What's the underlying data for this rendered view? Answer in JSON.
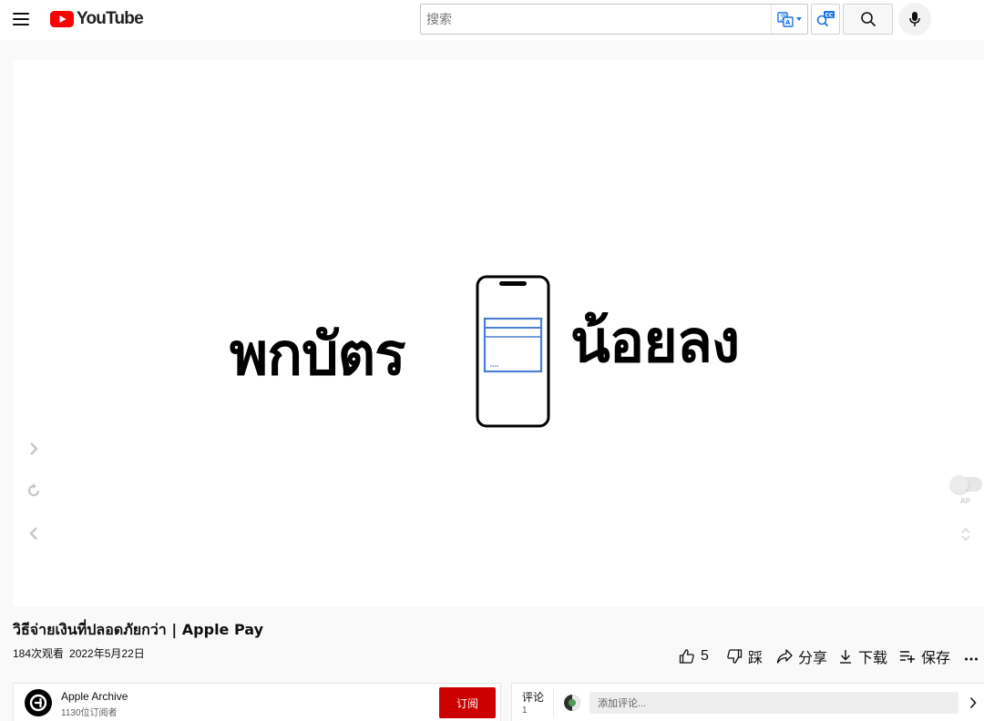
{
  "header": {
    "logo_text": "YouTube",
    "search_placeholder": "搜索"
  },
  "player": {
    "overlay_text_left": "พกบัตร",
    "overlay_text_right": "น้อยลง",
    "autoplay_label": "AP"
  },
  "video": {
    "title": "วิธีจ่ายเงินที่ปลอดภัยกว่า | Apple Pay",
    "views": "184次观看",
    "date": "2022年5月22日"
  },
  "actions": {
    "like_count": "5",
    "dislike_label": "踩",
    "share_label": "分享",
    "download_label": "下载",
    "save_label": "保存"
  },
  "channel": {
    "name": "Apple Archive",
    "subscribers": "1130位订阅者",
    "subscribe_label": "订阅"
  },
  "comments": {
    "label": "评论",
    "count": "1",
    "input_placeholder": "添加评论..."
  },
  "colors": {
    "brand_red": "#ff0000",
    "subscribe_red": "#cc0000",
    "card_blue": "#4a7fd4"
  }
}
